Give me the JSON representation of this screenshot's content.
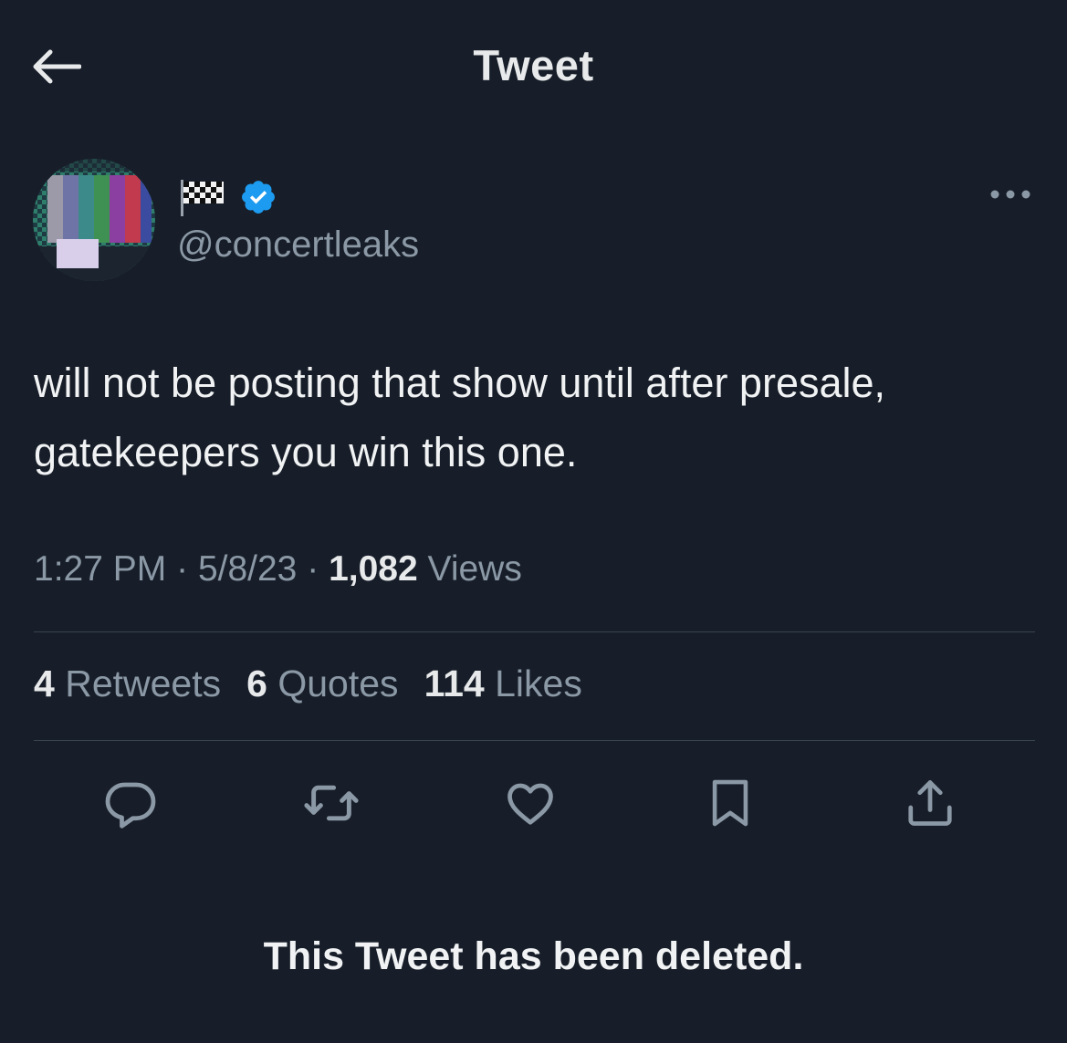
{
  "header": {
    "title": "Tweet",
    "back_icon": "arrow-left-icon"
  },
  "author": {
    "display_name_emoji": "🏁",
    "verified": true,
    "verified_color": "#1d9bf0",
    "handle": "@concertleaks",
    "avatar": "tv-color-bars-avatar",
    "more_icon": "more-horizontal-icon"
  },
  "tweet": {
    "text": "will not be posting that show until after presale, gatekeepers you win this one.",
    "time": "1:27 PM",
    "date": "5/8/23",
    "separator": "·",
    "views_count": "1,082",
    "views_label": "Views"
  },
  "stats": {
    "retweets_count": "4",
    "retweets_label": "Retweets",
    "quotes_count": "6",
    "quotes_label": "Quotes",
    "likes_count": "114",
    "likes_label": "Likes"
  },
  "actions": [
    "reply-icon",
    "retweet-icon",
    "like-icon",
    "bookmark-icon",
    "share-icon"
  ],
  "notice": "This Tweet has been deleted.",
  "colors": {
    "background": "#171e29",
    "primary_text": "#e7e9ea",
    "secondary_text": "#8b98a5",
    "divider": "#38444d",
    "accent": "#1d9bf0"
  }
}
